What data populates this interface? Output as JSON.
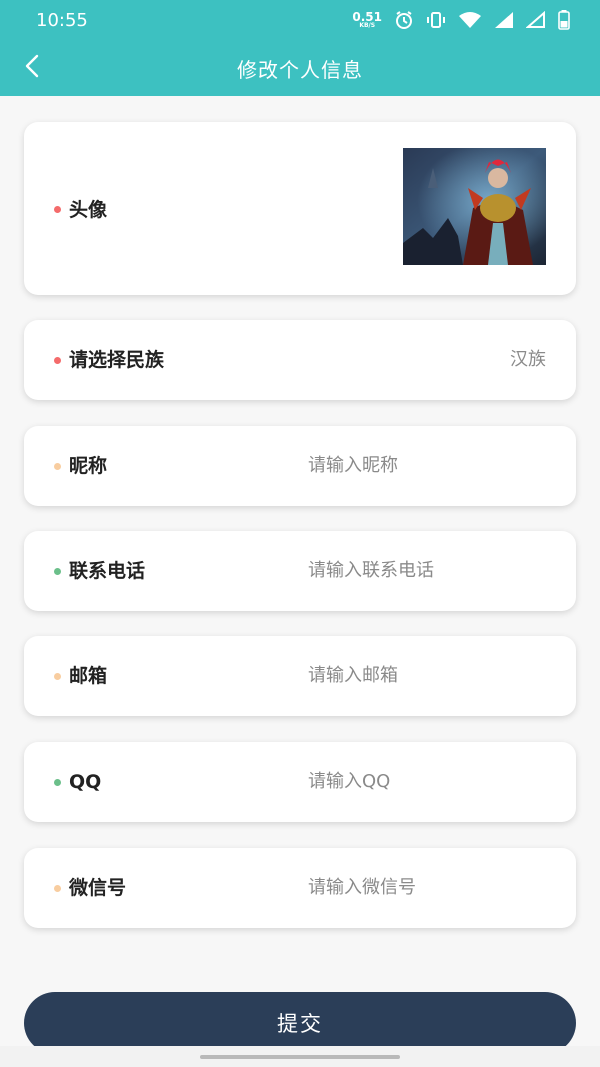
{
  "status_bar": {
    "time": "10:55",
    "net_speed": "0.51",
    "net_unit": "KB/S"
  },
  "header": {
    "title": "修改个人信息"
  },
  "form": {
    "avatar": {
      "label": "头像"
    },
    "ethnicity": {
      "label": "请选择民族",
      "value": "汉族"
    },
    "nickname": {
      "label": "昵称",
      "placeholder": "请输入昵称"
    },
    "phone": {
      "label": "联系电话",
      "placeholder": "请输入联系电话"
    },
    "email": {
      "label": "邮箱",
      "placeholder": "请输入邮箱"
    },
    "qq": {
      "label": "QQ",
      "placeholder": "请输入QQ"
    },
    "wechat": {
      "label": "微信号",
      "placeholder": "请输入微信号"
    }
  },
  "submit": {
    "label": "提交"
  },
  "colors": {
    "accent": "#3dc1c1",
    "button": "#2b3e58",
    "required_dot": "#f46b6b",
    "green_dot": "#6bbf8a",
    "optional_dot": "#f8cda0"
  }
}
